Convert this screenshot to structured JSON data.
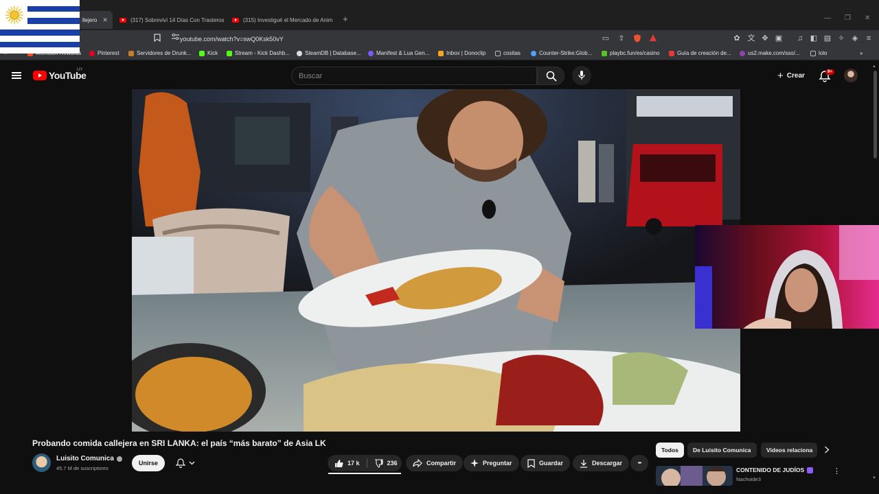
{
  "browser": {
    "tabs": [
      {
        "label": "llejero",
        "active": true
      },
      {
        "label": "(317) Sobreviví 14 Días Con Trasteros",
        "active": false
      },
      {
        "label": "(315) Investigué el Mercado de Anim",
        "active": false
      }
    ],
    "new_tab": "+",
    "url": "youtube.com/watch?v=swQ0Ksk50vY",
    "bookmarks": [
      {
        "label": "Microsoft Rewards",
        "color": "#f25022"
      },
      {
        "label": "Pinterest",
        "color": "#e60023"
      },
      {
        "label": "Servidores de Drunk...",
        "color": "#c77d2a"
      },
      {
        "label": "Kick",
        "color": "#53fc18"
      },
      {
        "label": "Stream - Kick Dashb...",
        "color": "#53fc18"
      },
      {
        "label": "SteamDB | Database...",
        "color": "#dddddd"
      },
      {
        "label": "Manifest & Lua Gen...",
        "color": "#7a5af8"
      },
      {
        "label": "Inbox | Donoclip",
        "color": "#f5a524"
      },
      {
        "label": "cositas",
        "color": "#bbbbbb"
      },
      {
        "label": "Counter-Strike:Glob...",
        "color": "#4aa3ff"
      },
      {
        "label": "playbc.fun/es/casino",
        "color": "#58c322"
      },
      {
        "label": "Guía de creación de...",
        "color": "#e53935"
      },
      {
        "label": "us2.make.com/sso/...",
        "color": "#8e44ad"
      },
      {
        "label": "lolo",
        "color": "#bbbbbb"
      }
    ],
    "more_bookmarks": "»"
  },
  "header": {
    "logo_text": "YouTube",
    "country_code": "UY",
    "search_placeholder": "Buscar",
    "create_label": "Crear",
    "notification_count": "9+"
  },
  "video": {
    "title": "Probando comida callejera en SRI LANKA: el país “más barato” de Asia LK",
    "channel": "Luisito Comunica",
    "subscribers": "45.7 M de suscriptores",
    "join_label": "Unirse"
  },
  "actions": {
    "likes": "17 k",
    "dislikes": "236",
    "share": "Compartir",
    "ask": "Preguntar",
    "save": "Guardar",
    "download": "Descargar",
    "more": "•••"
  },
  "related": {
    "chips": [
      "Todos",
      "De Luisito Comunica",
      "Videos relaciona"
    ],
    "items": [
      {
        "title": "CONTENIDO DE JUDÍOS",
        "channel": "Nachoide3"
      }
    ]
  },
  "colors": {
    "background": "#0f0f0f",
    "youtube_red": "#ff0000",
    "chip_bg": "#272727",
    "flag_blue": "#1a3fa6",
    "flag_sun": "#f4c430"
  },
  "icons": [
    "menu-icon",
    "youtube-logo-icon",
    "search-icon",
    "mic-icon",
    "plus-icon",
    "bell-icon",
    "like-icon",
    "dislike-icon",
    "share-icon",
    "sparkle-icon",
    "bookmark-icon",
    "download-icon",
    "chevron-right-icon",
    "kebab-menu-icon"
  ]
}
